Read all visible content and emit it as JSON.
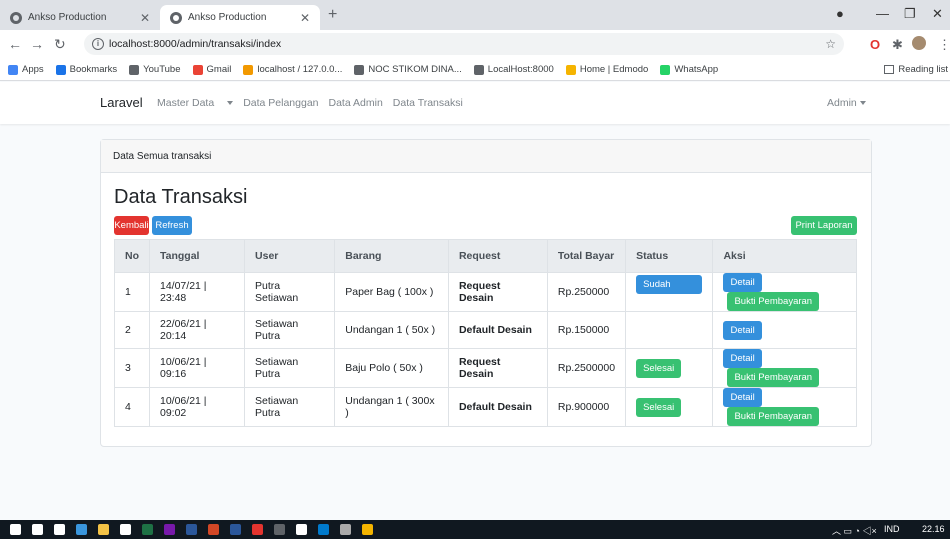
{
  "browser": {
    "tabs": [
      {
        "label": "Ankso Production",
        "active": false
      },
      {
        "label": "Ankso Production",
        "active": true
      }
    ],
    "new_tab_glyph": "+",
    "url": "localhost:8000/admin/transaksi/index",
    "window_controls": [
      "—",
      "❐",
      "✕"
    ],
    "bookmarks": [
      {
        "label": "Apps",
        "icon": "apps-grid-icon",
        "color": "#4285f4"
      },
      {
        "label": "Bookmarks",
        "icon": "star-icon",
        "color": "#1a73e8"
      },
      {
        "label": "YouTube",
        "icon": "globe-icon",
        "color": "#5f6368"
      },
      {
        "label": "Gmail",
        "icon": "gmail-icon",
        "color": "#ea4335"
      },
      {
        "label": "localhost / 127.0.0...",
        "icon": "phpmyadmin-icon",
        "color": "#f29900"
      },
      {
        "label": "NOC STIKOM DINA...",
        "icon": "globe-icon",
        "color": "#5f6368"
      },
      {
        "label": "LocalHost:8000",
        "icon": "globe-icon",
        "color": "#5f6368"
      },
      {
        "label": "Home | Edmodo",
        "icon": "edmodo-icon",
        "color": "#f5b400"
      },
      {
        "label": "WhatsApp",
        "icon": "whatsapp-icon",
        "color": "#25d366"
      }
    ],
    "reading_list": "Reading list"
  },
  "navbar": {
    "brand": "Laravel",
    "links": [
      {
        "label": "Master Data",
        "dropdown": true
      },
      {
        "label": "Data Pelanggan",
        "dropdown": false
      },
      {
        "label": "Data Admin",
        "dropdown": false
      },
      {
        "label": "Data Transaksi",
        "dropdown": false
      }
    ],
    "user_menu": "Admin"
  },
  "card": {
    "header": "Data Semua transaksi",
    "title": "Data Transaksi",
    "buttons": {
      "back": "Kembali",
      "refresh": "Refresh",
      "print": "Print Laporan"
    },
    "table": {
      "columns": [
        "No",
        "Tanggal",
        "User",
        "Barang",
        "Request",
        "Total Bayar",
        "Status",
        "Aksi"
      ],
      "rows": [
        {
          "no": "1",
          "tanggal": "14/07/21 | 23:48",
          "user": "Putra Setiawan",
          "barang": "Paper Bag ( 100x )",
          "request": "Request Desain",
          "total": "Rp.250000",
          "status": "Sudah Bayar",
          "status_color": "#3490dc",
          "actions": [
            "Detail",
            "Bukti Pembayaran"
          ]
        },
        {
          "no": "2",
          "tanggal": "22/06/21 | 20:14",
          "user": "Setiawan Putra",
          "barang": "Undangan 1 ( 50x )",
          "request": "Default Desain",
          "total": "Rp.150000",
          "status": "",
          "status_color": "",
          "actions": [
            "Detail"
          ]
        },
        {
          "no": "3",
          "tanggal": "10/06/21 | 09:16",
          "user": "Setiawan Putra",
          "barang": "Baju Polo ( 50x )",
          "request": "Request Desain",
          "total": "Rp.2500000",
          "status": "Selesai",
          "status_color": "#38c172",
          "actions": [
            "Detail",
            "Bukti Pembayaran"
          ]
        },
        {
          "no": "4",
          "tanggal": "10/06/21 | 09:02",
          "user": "Setiawan Putra",
          "barang": "Undangan 1 ( 300x )",
          "request": "Default Desain",
          "total": "Rp.900000",
          "status": "Selesai",
          "status_color": "#38c172",
          "actions": [
            "Detail",
            "Bukti Pembayaran"
          ]
        }
      ]
    }
  },
  "taskbar": {
    "lang": "IND",
    "time": "22.16",
    "apps": [
      {
        "icon": "windows-start-icon",
        "color": "#ffffff"
      },
      {
        "icon": "search-icon",
        "color": "#ffffff"
      },
      {
        "icon": "task-view-icon",
        "color": "#ffffff"
      },
      {
        "icon": "edge-icon",
        "color": "#3a96dd"
      },
      {
        "icon": "file-explorer-icon",
        "color": "#f3c246"
      },
      {
        "icon": "store-icon",
        "color": "#ffffff"
      },
      {
        "icon": "excel-icon",
        "color": "#1e7145"
      },
      {
        "icon": "onenote-icon",
        "color": "#7719aa"
      },
      {
        "icon": "word-icon",
        "color": "#2b579a"
      },
      {
        "icon": "powerpoint-icon",
        "color": "#d24726"
      },
      {
        "icon": "access-icon",
        "color": "#2b579a"
      },
      {
        "icon": "app-icon",
        "color": "#e3342f"
      },
      {
        "icon": "app-icon",
        "color": "#5f6368"
      },
      {
        "icon": "app-icon",
        "color": "#ffffff"
      },
      {
        "icon": "vscode-icon",
        "color": "#007acc"
      },
      {
        "icon": "terminal-icon",
        "color": "#aaaaaa"
      },
      {
        "icon": "chrome-icon",
        "color": "#f4b400"
      }
    ]
  }
}
